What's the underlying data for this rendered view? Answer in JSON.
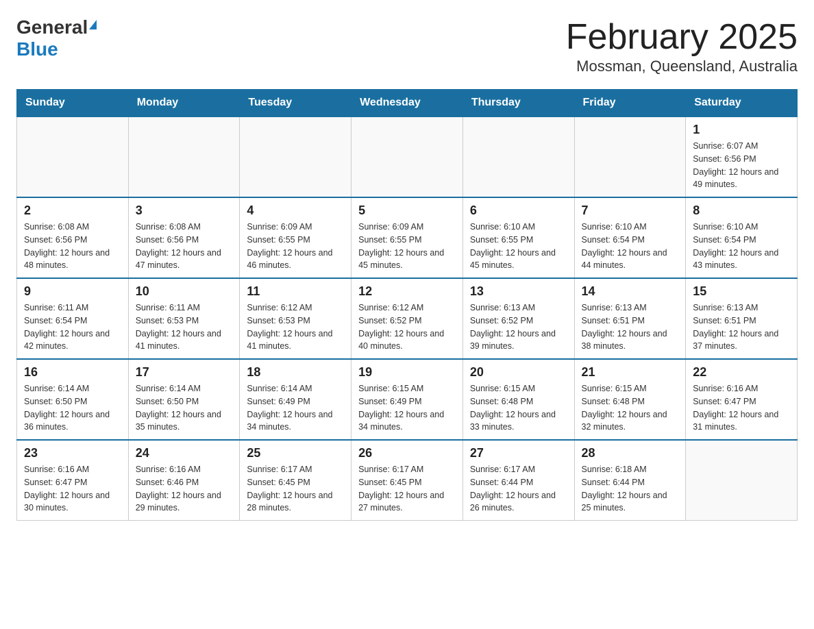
{
  "header": {
    "logo_general": "General",
    "logo_blue": "Blue",
    "title": "February 2025",
    "subtitle": "Mossman, Queensland, Australia"
  },
  "weekdays": [
    "Sunday",
    "Monday",
    "Tuesday",
    "Wednesday",
    "Thursday",
    "Friday",
    "Saturday"
  ],
  "weeks": [
    [
      {
        "day": "",
        "info": ""
      },
      {
        "day": "",
        "info": ""
      },
      {
        "day": "",
        "info": ""
      },
      {
        "day": "",
        "info": ""
      },
      {
        "day": "",
        "info": ""
      },
      {
        "day": "",
        "info": ""
      },
      {
        "day": "1",
        "info": "Sunrise: 6:07 AM\nSunset: 6:56 PM\nDaylight: 12 hours and 49 minutes."
      }
    ],
    [
      {
        "day": "2",
        "info": "Sunrise: 6:08 AM\nSunset: 6:56 PM\nDaylight: 12 hours and 48 minutes."
      },
      {
        "day": "3",
        "info": "Sunrise: 6:08 AM\nSunset: 6:56 PM\nDaylight: 12 hours and 47 minutes."
      },
      {
        "day": "4",
        "info": "Sunrise: 6:09 AM\nSunset: 6:55 PM\nDaylight: 12 hours and 46 minutes."
      },
      {
        "day": "5",
        "info": "Sunrise: 6:09 AM\nSunset: 6:55 PM\nDaylight: 12 hours and 45 minutes."
      },
      {
        "day": "6",
        "info": "Sunrise: 6:10 AM\nSunset: 6:55 PM\nDaylight: 12 hours and 45 minutes."
      },
      {
        "day": "7",
        "info": "Sunrise: 6:10 AM\nSunset: 6:54 PM\nDaylight: 12 hours and 44 minutes."
      },
      {
        "day": "8",
        "info": "Sunrise: 6:10 AM\nSunset: 6:54 PM\nDaylight: 12 hours and 43 minutes."
      }
    ],
    [
      {
        "day": "9",
        "info": "Sunrise: 6:11 AM\nSunset: 6:54 PM\nDaylight: 12 hours and 42 minutes."
      },
      {
        "day": "10",
        "info": "Sunrise: 6:11 AM\nSunset: 6:53 PM\nDaylight: 12 hours and 41 minutes."
      },
      {
        "day": "11",
        "info": "Sunrise: 6:12 AM\nSunset: 6:53 PM\nDaylight: 12 hours and 41 minutes."
      },
      {
        "day": "12",
        "info": "Sunrise: 6:12 AM\nSunset: 6:52 PM\nDaylight: 12 hours and 40 minutes."
      },
      {
        "day": "13",
        "info": "Sunrise: 6:13 AM\nSunset: 6:52 PM\nDaylight: 12 hours and 39 minutes."
      },
      {
        "day": "14",
        "info": "Sunrise: 6:13 AM\nSunset: 6:51 PM\nDaylight: 12 hours and 38 minutes."
      },
      {
        "day": "15",
        "info": "Sunrise: 6:13 AM\nSunset: 6:51 PM\nDaylight: 12 hours and 37 minutes."
      }
    ],
    [
      {
        "day": "16",
        "info": "Sunrise: 6:14 AM\nSunset: 6:50 PM\nDaylight: 12 hours and 36 minutes."
      },
      {
        "day": "17",
        "info": "Sunrise: 6:14 AM\nSunset: 6:50 PM\nDaylight: 12 hours and 35 minutes."
      },
      {
        "day": "18",
        "info": "Sunrise: 6:14 AM\nSunset: 6:49 PM\nDaylight: 12 hours and 34 minutes."
      },
      {
        "day": "19",
        "info": "Sunrise: 6:15 AM\nSunset: 6:49 PM\nDaylight: 12 hours and 34 minutes."
      },
      {
        "day": "20",
        "info": "Sunrise: 6:15 AM\nSunset: 6:48 PM\nDaylight: 12 hours and 33 minutes."
      },
      {
        "day": "21",
        "info": "Sunrise: 6:15 AM\nSunset: 6:48 PM\nDaylight: 12 hours and 32 minutes."
      },
      {
        "day": "22",
        "info": "Sunrise: 6:16 AM\nSunset: 6:47 PM\nDaylight: 12 hours and 31 minutes."
      }
    ],
    [
      {
        "day": "23",
        "info": "Sunrise: 6:16 AM\nSunset: 6:47 PM\nDaylight: 12 hours and 30 minutes."
      },
      {
        "day": "24",
        "info": "Sunrise: 6:16 AM\nSunset: 6:46 PM\nDaylight: 12 hours and 29 minutes."
      },
      {
        "day": "25",
        "info": "Sunrise: 6:17 AM\nSunset: 6:45 PM\nDaylight: 12 hours and 28 minutes."
      },
      {
        "day": "26",
        "info": "Sunrise: 6:17 AM\nSunset: 6:45 PM\nDaylight: 12 hours and 27 minutes."
      },
      {
        "day": "27",
        "info": "Sunrise: 6:17 AM\nSunset: 6:44 PM\nDaylight: 12 hours and 26 minutes."
      },
      {
        "day": "28",
        "info": "Sunrise: 6:18 AM\nSunset: 6:44 PM\nDaylight: 12 hours and 25 minutes."
      },
      {
        "day": "",
        "info": ""
      }
    ]
  ]
}
